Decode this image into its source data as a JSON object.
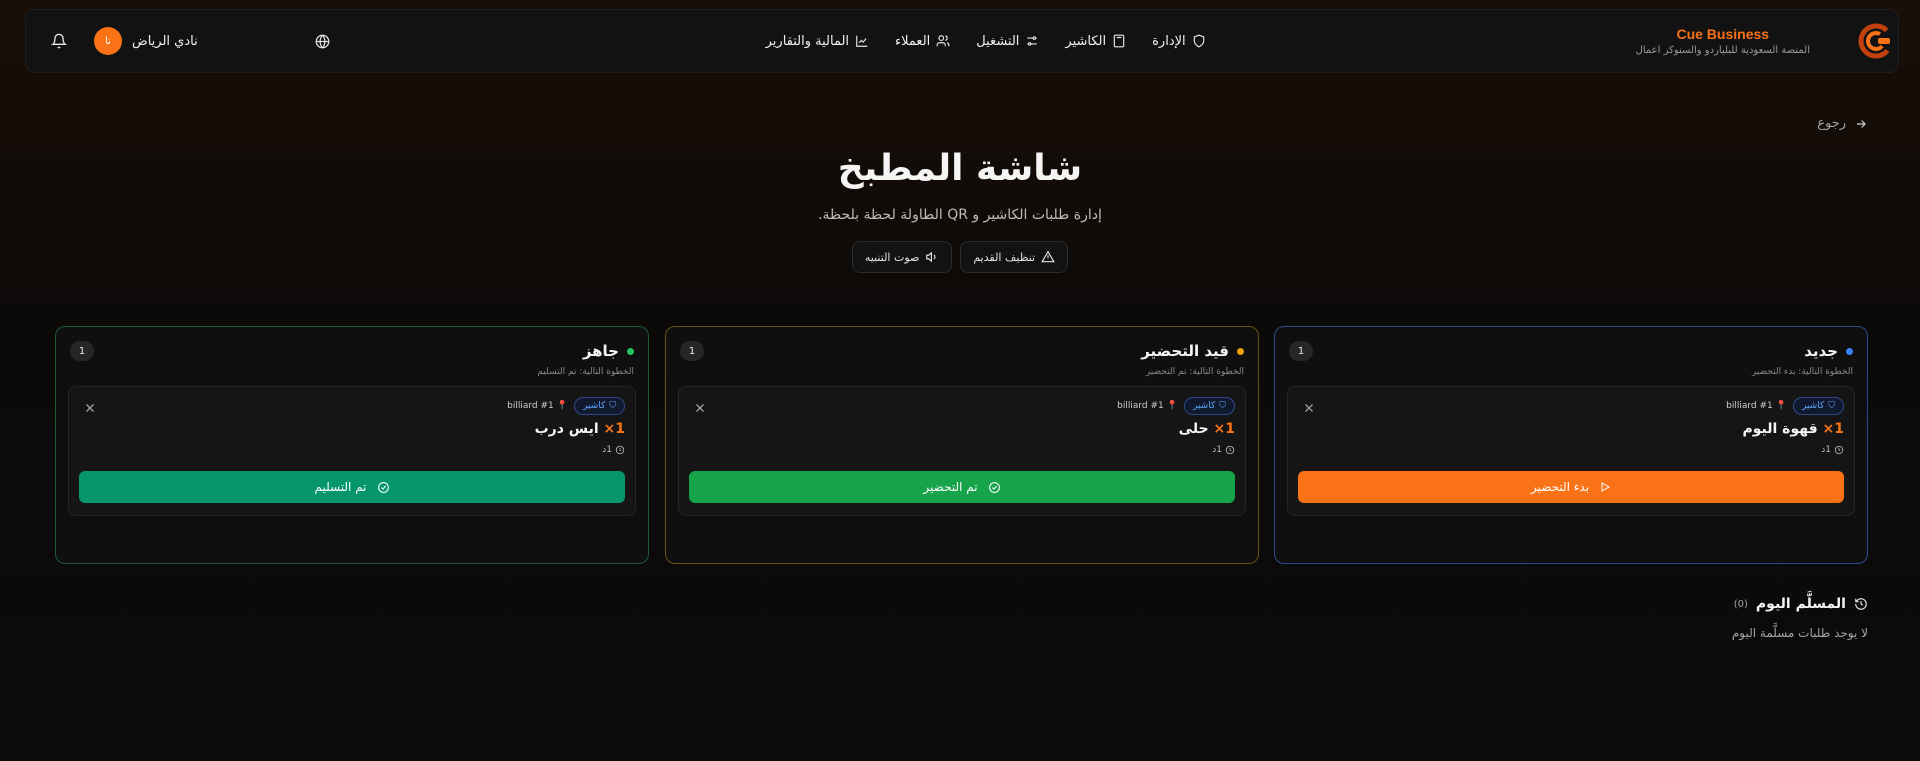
{
  "brand": {
    "title": "Cue Business",
    "subtitle": "المنصة السعودية للبلياردو والسنوكر اعمال"
  },
  "nav": [
    {
      "label": "الإدارة",
      "icon": "shield-icon"
    },
    {
      "label": "الكاشير",
      "icon": "calculator-icon"
    },
    {
      "label": "التشغيل",
      "icon": "sliders-icon"
    },
    {
      "label": "العملاء",
      "icon": "users-icon"
    },
    {
      "label": "المالية والتقارير",
      "icon": "chart-icon"
    }
  ],
  "user": {
    "club": "نادي الرياض",
    "avatar": "نا"
  },
  "back_label": "رجوع",
  "hero": {
    "title": "شاشة المطبخ",
    "subtitle": "إدارة طلبات الكاشير و QR الطاولة لحظة بلحظة.",
    "clean_label": "تنظيف القديم",
    "sound_label": "صوت التنبيه"
  },
  "columns": {
    "new": {
      "title": "جديد",
      "count": "1",
      "next": "الخطوة التالية: بدء التحضير",
      "dot_color": "#3b82f6",
      "card": {
        "tag": "كاشير",
        "table": "billiard #1",
        "qty": "1×",
        "item": "قهوة اليوم",
        "time": "1د",
        "action": "بدء التحضير"
      }
    },
    "prep": {
      "title": "قيد التحضير",
      "count": "1",
      "next": "الخطوة التالية: تم التحضير",
      "dot_color": "#f59e0b",
      "card": {
        "tag": "كاشير",
        "table": "billiard #1",
        "qty": "1×",
        "item": "حلى",
        "time": "1د",
        "action": "تم التحضير"
      }
    },
    "ready": {
      "title": "جاهز",
      "count": "1",
      "next": "الخطوة التالية: تم التسليم",
      "dot_color": "#22c55e",
      "card": {
        "tag": "كاشير",
        "table": "billiard #1",
        "qty": "1×",
        "item": "ايس درب",
        "time": "1د",
        "action": "تم التسليم"
      }
    }
  },
  "delivered": {
    "title": "المسلَّم اليوم",
    "count": "(0)",
    "empty": "لا يوجد طلبات مسلَّمة اليوم"
  },
  "colors": {
    "accent": "#f97316",
    "new": "#3b82f6",
    "prep": "#f59e0b",
    "ready": "#22c55e"
  }
}
